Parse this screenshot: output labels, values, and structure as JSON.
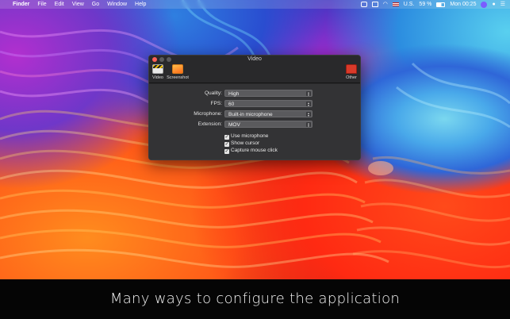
{
  "menubar": {
    "apple_icon": "apple-icon",
    "app_name": "Finder",
    "menus": [
      "File",
      "Edit",
      "View",
      "Go",
      "Window",
      "Help"
    ],
    "input_source": "U.S.",
    "battery": "59 %",
    "clock": "Mon 00:25"
  },
  "window": {
    "title": "Video",
    "toolbar": {
      "video_label": "Video",
      "screenshot_label": "Screenshot",
      "other_label": "Other"
    },
    "settings": [
      {
        "label": "Quality:",
        "value": "High"
      },
      {
        "label": "FPS:",
        "value": "60"
      },
      {
        "label": "Microphone:",
        "value": "Built-in microphone"
      },
      {
        "label": "Extension:",
        "value": "MOV"
      }
    ],
    "checkboxes": [
      {
        "label": "Use microphone",
        "checked": true
      },
      {
        "label": "Show cursor",
        "checked": true
      },
      {
        "label": "Capture mouse click",
        "checked": true
      }
    ]
  },
  "caption": "Many ways to configure the application",
  "colors": {
    "close": "#ff5f57",
    "minimize": "#5a5a5c",
    "zoom": "#5a5a5c"
  }
}
